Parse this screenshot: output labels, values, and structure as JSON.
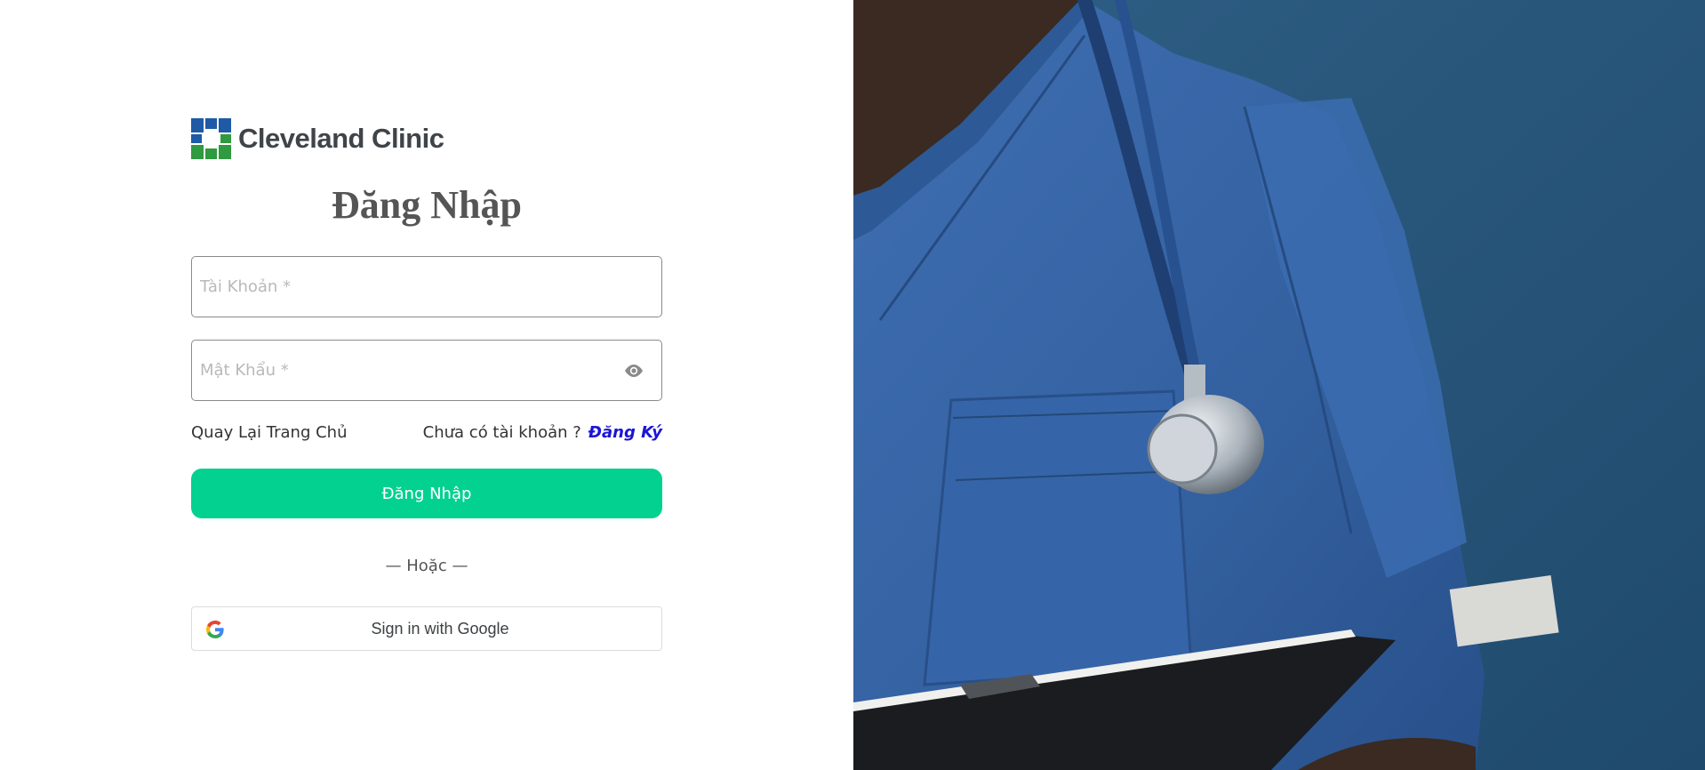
{
  "brand": {
    "name": "Cleveland Clinic",
    "colors": {
      "blue": "#1f5aa6",
      "green": "#2f9a3f"
    }
  },
  "login": {
    "title": "Đăng Nhập",
    "username_placeholder": "Tài Khoản *",
    "password_placeholder": "Mật Khẩu *",
    "back_home": "Quay Lại Trang Chủ",
    "no_account": "Chưa có tài khoản ?",
    "register": "Đăng Ký",
    "submit": "Đăng Nhập",
    "or": "— Hoặc —",
    "google": "Sign in with Google",
    "accent_color": "#03d18f",
    "link_color": "#1a14d8"
  },
  "hero": {
    "icons": [
      "eye-icon",
      "google-icon"
    ]
  }
}
